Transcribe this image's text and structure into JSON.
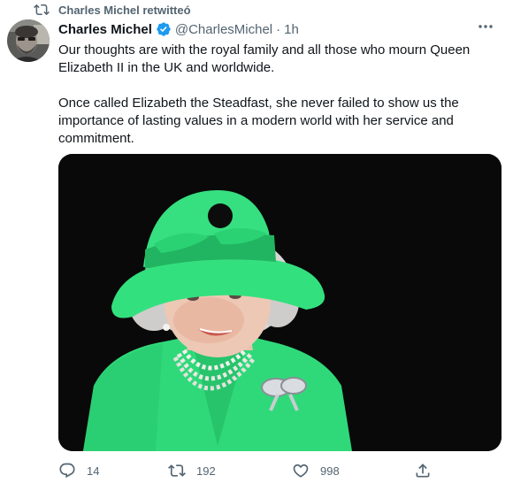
{
  "retweet": {
    "icon": "retweet-icon",
    "text": "Charles Michel retwitteó"
  },
  "tweet": {
    "author_name": "Charles Michel",
    "verified_icon": "verified-badge-icon",
    "handle": "@CharlesMichel",
    "separator": "·",
    "time": "1h",
    "more_icon": "more-options-icon",
    "paragraphs": [
      "Our thoughts are with the royal family and all those who mourn Queen Elizabeth II in the UK and worldwide.",
      "Once called Elizabeth the Steadfast, she never failed to show us the importance of lasting values in a modern world with her service and commitment."
    ]
  },
  "actions": {
    "reply": {
      "icon": "reply-icon",
      "count": "14"
    },
    "retweet": {
      "icon": "retweet-icon",
      "count": "192"
    },
    "like": {
      "icon": "like-icon",
      "count": "998"
    },
    "share": {
      "icon": "share-icon"
    }
  },
  "colors": {
    "accent": "#1d9bf0",
    "secondary_text": "#536471",
    "primary_text": "#0f1419",
    "media_background": "#090909",
    "outfit_green": "#2fd97a"
  }
}
